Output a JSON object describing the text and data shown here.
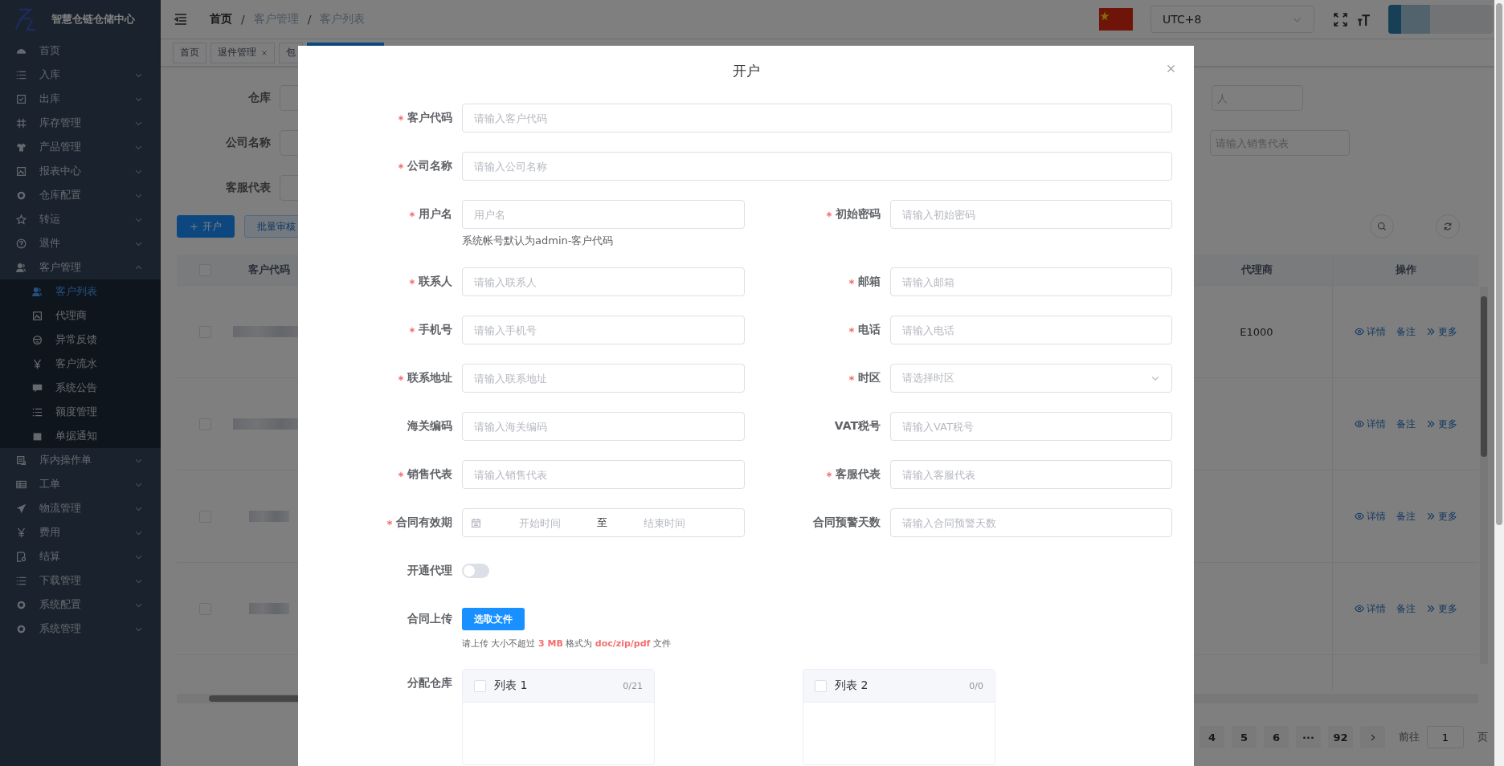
{
  "sidebar": {
    "title": "智慧仓链仓储中心",
    "items": [
      {
        "label": "首页",
        "selected": false
      },
      {
        "label": "入库",
        "selected": false,
        "expanded": false
      },
      {
        "label": "出库",
        "selected": false,
        "expanded": false
      },
      {
        "label": "库存管理",
        "selected": false,
        "expanded": false
      },
      {
        "label": "产品管理",
        "selected": false,
        "expanded": false
      },
      {
        "label": "报表中心",
        "selected": false,
        "expanded": false
      },
      {
        "label": "仓库配置",
        "selected": false,
        "expanded": false
      },
      {
        "label": "转运",
        "selected": false,
        "expanded": false
      },
      {
        "label": "退件",
        "selected": false,
        "expanded": false
      },
      {
        "label": "客户管理",
        "selected": false,
        "expanded": true,
        "children": [
          {
            "label": "客户列表",
            "selected": true
          },
          {
            "label": "代理商",
            "selected": false
          },
          {
            "label": "异常反馈",
            "selected": false
          },
          {
            "label": "客户流水",
            "selected": false
          },
          {
            "label": "系统公告",
            "selected": false
          },
          {
            "label": "额度管理",
            "selected": false
          },
          {
            "label": "单据通知",
            "selected": false
          }
        ]
      },
      {
        "label": "库内操作单",
        "selected": false,
        "expanded": false
      },
      {
        "label": "工单",
        "selected": false,
        "expanded": false
      },
      {
        "label": "物流管理",
        "selected": false,
        "expanded": false
      },
      {
        "label": "费用",
        "selected": false,
        "expanded": false
      },
      {
        "label": "结算",
        "selected": false,
        "expanded": false
      },
      {
        "label": "下载管理",
        "selected": false,
        "expanded": false
      },
      {
        "label": "系统配置",
        "selected": false,
        "expanded": false
      },
      {
        "label": "系统管理",
        "selected": false,
        "expanded": false
      }
    ]
  },
  "header": {
    "breadcrumb": [
      "首页",
      "客户管理",
      "客户列表"
    ],
    "separator": "/",
    "timezone": "UTC+8"
  },
  "tabs": [
    {
      "label": "首页",
      "selected": false,
      "closable": false
    },
    {
      "label": "退件管理",
      "selected": false,
      "closable": true
    },
    {
      "label": "包",
      "selected": false,
      "closable": false
    },
    {
      "selected": true,
      "closable": false
    }
  ],
  "filters": {
    "labels": [
      "仓库",
      "公司名称",
      "客服代表"
    ],
    "right_fields": [
      {
        "placeholder": "人"
      },
      {
        "placeholder": "请输入销售代表"
      }
    ]
  },
  "toolbar": {
    "buttons": [
      {
        "label": "开户",
        "kind": "primary"
      },
      {
        "label": "批量审核",
        "kind": "plain"
      }
    ]
  },
  "table": {
    "select_all": {
      "checked": false
    },
    "columns": [
      "客户代码",
      "代理商",
      "操作"
    ],
    "rows": [
      {
        "checked": false,
        "agent": "E1000",
        "actions": [
          "详情",
          "备注",
          "更多"
        ]
      },
      {
        "checked": false,
        "actions": [
          "详情",
          "备注",
          "更多"
        ]
      },
      {
        "checked": false,
        "actions": [
          "详情",
          "备注",
          "更多"
        ]
      },
      {
        "checked": false,
        "actions": [
          "详情",
          "备注",
          "更多"
        ]
      }
    ]
  },
  "pagination": {
    "pages": [
      "4",
      "5",
      "6",
      "···",
      "92"
    ],
    "goto_label": "前往",
    "goto_value": "1",
    "page_unit": "页"
  },
  "dialog": {
    "title": "开户",
    "rows": [
      {
        "fields": [
          {
            "kind": "input",
            "label": "客户代码",
            "required": true,
            "placeholder": "请输入客户代码"
          }
        ]
      },
      {
        "fields": [
          {
            "kind": "input",
            "label": "公司名称",
            "required": true,
            "placeholder": "请输入公司名称"
          }
        ]
      },
      {
        "fields": [
          {
            "kind": "input",
            "label": "用户名",
            "required": true,
            "placeholder": "用户名",
            "help": "系统帐号默认为admin-客户代码"
          },
          {
            "kind": "input",
            "label": "初始密码",
            "required": true,
            "placeholder": "请输入初始密码"
          }
        ]
      },
      {
        "fields": [
          {
            "kind": "input",
            "label": "联系人",
            "required": true,
            "placeholder": "请输入联系人"
          },
          {
            "kind": "input",
            "label": "邮箱",
            "required": true,
            "placeholder": "请输入邮箱"
          }
        ]
      },
      {
        "fields": [
          {
            "kind": "input",
            "label": "手机号",
            "required": true,
            "placeholder": "请输入手机号"
          },
          {
            "kind": "input",
            "label": "电话",
            "required": true,
            "placeholder": "请输入电话"
          }
        ]
      },
      {
        "fields": [
          {
            "kind": "input",
            "label": "联系地址",
            "required": true,
            "placeholder": "请输入联系地址"
          },
          {
            "kind": "select",
            "label": "时区",
            "required": true,
            "placeholder": "请选择时区"
          }
        ]
      },
      {
        "fields": [
          {
            "kind": "input",
            "label": "海关编码",
            "required": false,
            "placeholder": "请输入海关编码"
          },
          {
            "kind": "input",
            "label": "VAT税号",
            "required": false,
            "placeholder": "请输入VAT税号"
          }
        ]
      },
      {
        "fields": [
          {
            "kind": "input",
            "label": "销售代表",
            "required": true,
            "placeholder": "请输入销售代表"
          },
          {
            "kind": "input",
            "label": "客服代表",
            "required": true,
            "placeholder": "请输入客服代表"
          }
        ]
      },
      {
        "fields": [
          {
            "kind": "daterange",
            "label": "合同有效期",
            "required": true,
            "start_placeholder": "开始时间",
            "separator": "至",
            "end_placeholder": "结束时间"
          },
          {
            "kind": "input",
            "label": "合同预警天数",
            "required": false,
            "placeholder": "请输入合同预警天数"
          }
        ]
      },
      {
        "fields": [
          {
            "kind": "switch",
            "label": "开通代理",
            "required": false,
            "on": false
          }
        ]
      },
      {
        "fields": [
          {
            "kind": "upload",
            "label": "合同上传",
            "required": false,
            "button": "选取文件",
            "hint": "请上传 大小不超过 **3 MB** 格式为 **doc/zip/pdf** 文件"
          }
        ]
      },
      {
        "fields": [
          {
            "kind": "transfer",
            "label": "分配仓库",
            "required": false,
            "panels": [
              {
                "title": "列表 1",
                "count": "0/21",
                "checked": false
              },
              {
                "title": "列表 2",
                "count": "0/0",
                "checked": false
              }
            ]
          }
        ]
      }
    ]
  }
}
